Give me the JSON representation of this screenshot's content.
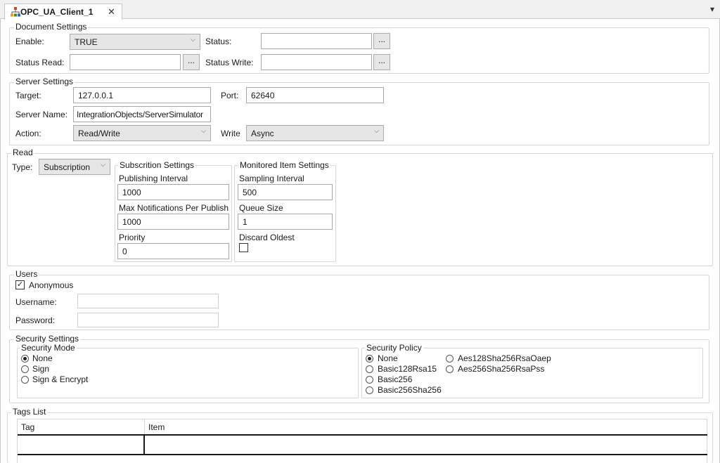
{
  "tab": {
    "title": "OPC_UA_Client_1",
    "close": "✕",
    "overflow": "▾"
  },
  "document_settings": {
    "title": "Document Settings",
    "enable_label": "Enable:",
    "enable_value": "TRUE",
    "status_label": "Status:",
    "status_value": "",
    "status_read_label": "Status Read:",
    "status_read_value": "",
    "status_write_label": "Status Write:",
    "status_write_value": "",
    "browse": "..."
  },
  "server_settings": {
    "title": "Server Settings",
    "target_label": "Target:",
    "target_value": "127.0.0.1",
    "port_label": "Port:",
    "port_value": "62640",
    "server_name_label": "Server Name:",
    "server_name_value": "IntegrationObjects/ServerSimulator",
    "action_label": "Action:",
    "action_value": "Read/Write",
    "write_label": "Write",
    "write_value": "Async"
  },
  "read": {
    "title": "Read",
    "type_label": "Type:",
    "type_value": "Subscription",
    "subscription": {
      "title": "Subscrition Settings",
      "publishing_interval_label": "Publishing Interval",
      "publishing_interval_value": "1000",
      "max_notifications_label": "Max Notifications Per Publish",
      "max_notifications_value": "1000",
      "priority_label": "Priority",
      "priority_value": "0"
    },
    "monitored": {
      "title": "Monitored Item Settings",
      "sampling_interval_label": "Sampling Interval",
      "sampling_interval_value": "500",
      "queue_size_label": "Queue Size",
      "queue_size_value": "1",
      "discard_oldest_label": "Discard Oldest",
      "discard_oldest_checked": false
    }
  },
  "users": {
    "title": "Users",
    "anonymous_label": "Anonymous",
    "anonymous_checked": true,
    "username_label": "Username:",
    "username_value": "",
    "password_label": "Password:",
    "password_value": ""
  },
  "security": {
    "title": "Security Settings",
    "mode_title": "Security Mode",
    "modes": [
      "None",
      "Sign",
      "Sign & Encrypt"
    ],
    "mode_selected": "None",
    "policy_title": "Security Policy",
    "policies": [
      "None",
      "Basic128Rsa15",
      "Basic256",
      "Basic256Sha256",
      "Aes128Sha256RsaOaep",
      "Aes256Sha256RsaPss"
    ],
    "policy_selected": "None"
  },
  "tags_list": {
    "title": "Tags List",
    "columns": [
      "Tag",
      "Item"
    ]
  },
  "colors": {
    "border": "#d6d6d6",
    "combo_bg": "#e6e6e6",
    "tab_strip": "#f0f0f0"
  }
}
